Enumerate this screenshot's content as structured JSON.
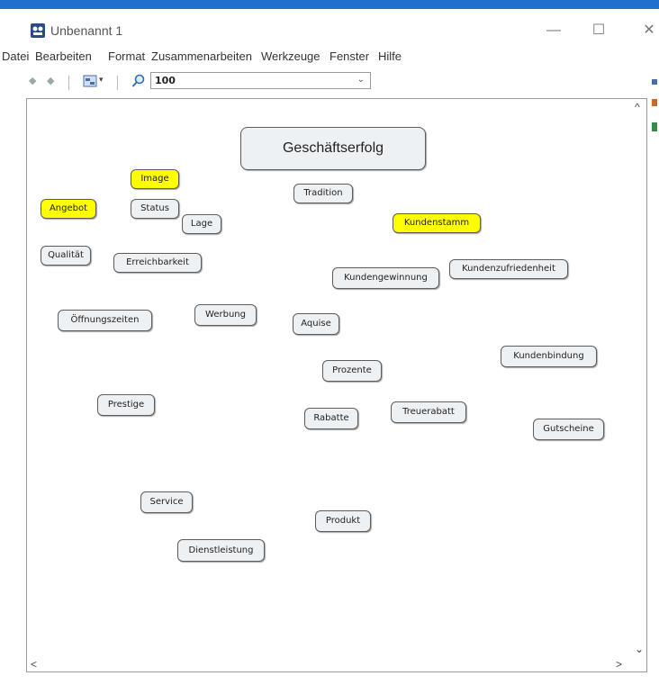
{
  "window": {
    "title": "Unbenannt 1",
    "controls": {
      "minimize": "—",
      "maximize": "☐",
      "close": "✕"
    }
  },
  "menu": [
    "Datei",
    "Bearbeiten",
    "Format",
    "Zusammenarbeiten",
    "Werkzeuge",
    "Fenster",
    "Hilfe"
  ],
  "toolbar": {
    "zoom_value": "100"
  },
  "colors": {
    "title_bar_accent": "#1f6fd0",
    "highlight": "#ffff00",
    "node_fill": "#eef1f4"
  },
  "nodes": {
    "root": "Geschäftserfolg",
    "image": "Image",
    "angebot": "Angebot",
    "status": "Status",
    "lage": "Lage",
    "tradition": "Tradition",
    "kundenstamm": "Kundenstamm",
    "qualitaet": "Qualität",
    "erreichbarkeit": "Erreichbarkeit",
    "kundengewinnung": "Kundengewinnung",
    "kundenzufriedenheit": "Kundenzufriedenheit",
    "oeffnungszeiten": "Öffnungszeiten",
    "werbung": "Werbung",
    "aquise": "Aquise",
    "kundenbindung": "Kundenbindung",
    "prozente": "Prozente",
    "prestige": "Prestige",
    "rabatte": "Rabatte",
    "treuerabatt": "Treuerabatt",
    "gutscheine": "Gutscheine",
    "service": "Service",
    "produkt": "Produkt",
    "dienstleistung": "Dienstleistung"
  },
  "highlighted_nodes": [
    "Image",
    "Angebot",
    "Kundenstamm"
  ]
}
